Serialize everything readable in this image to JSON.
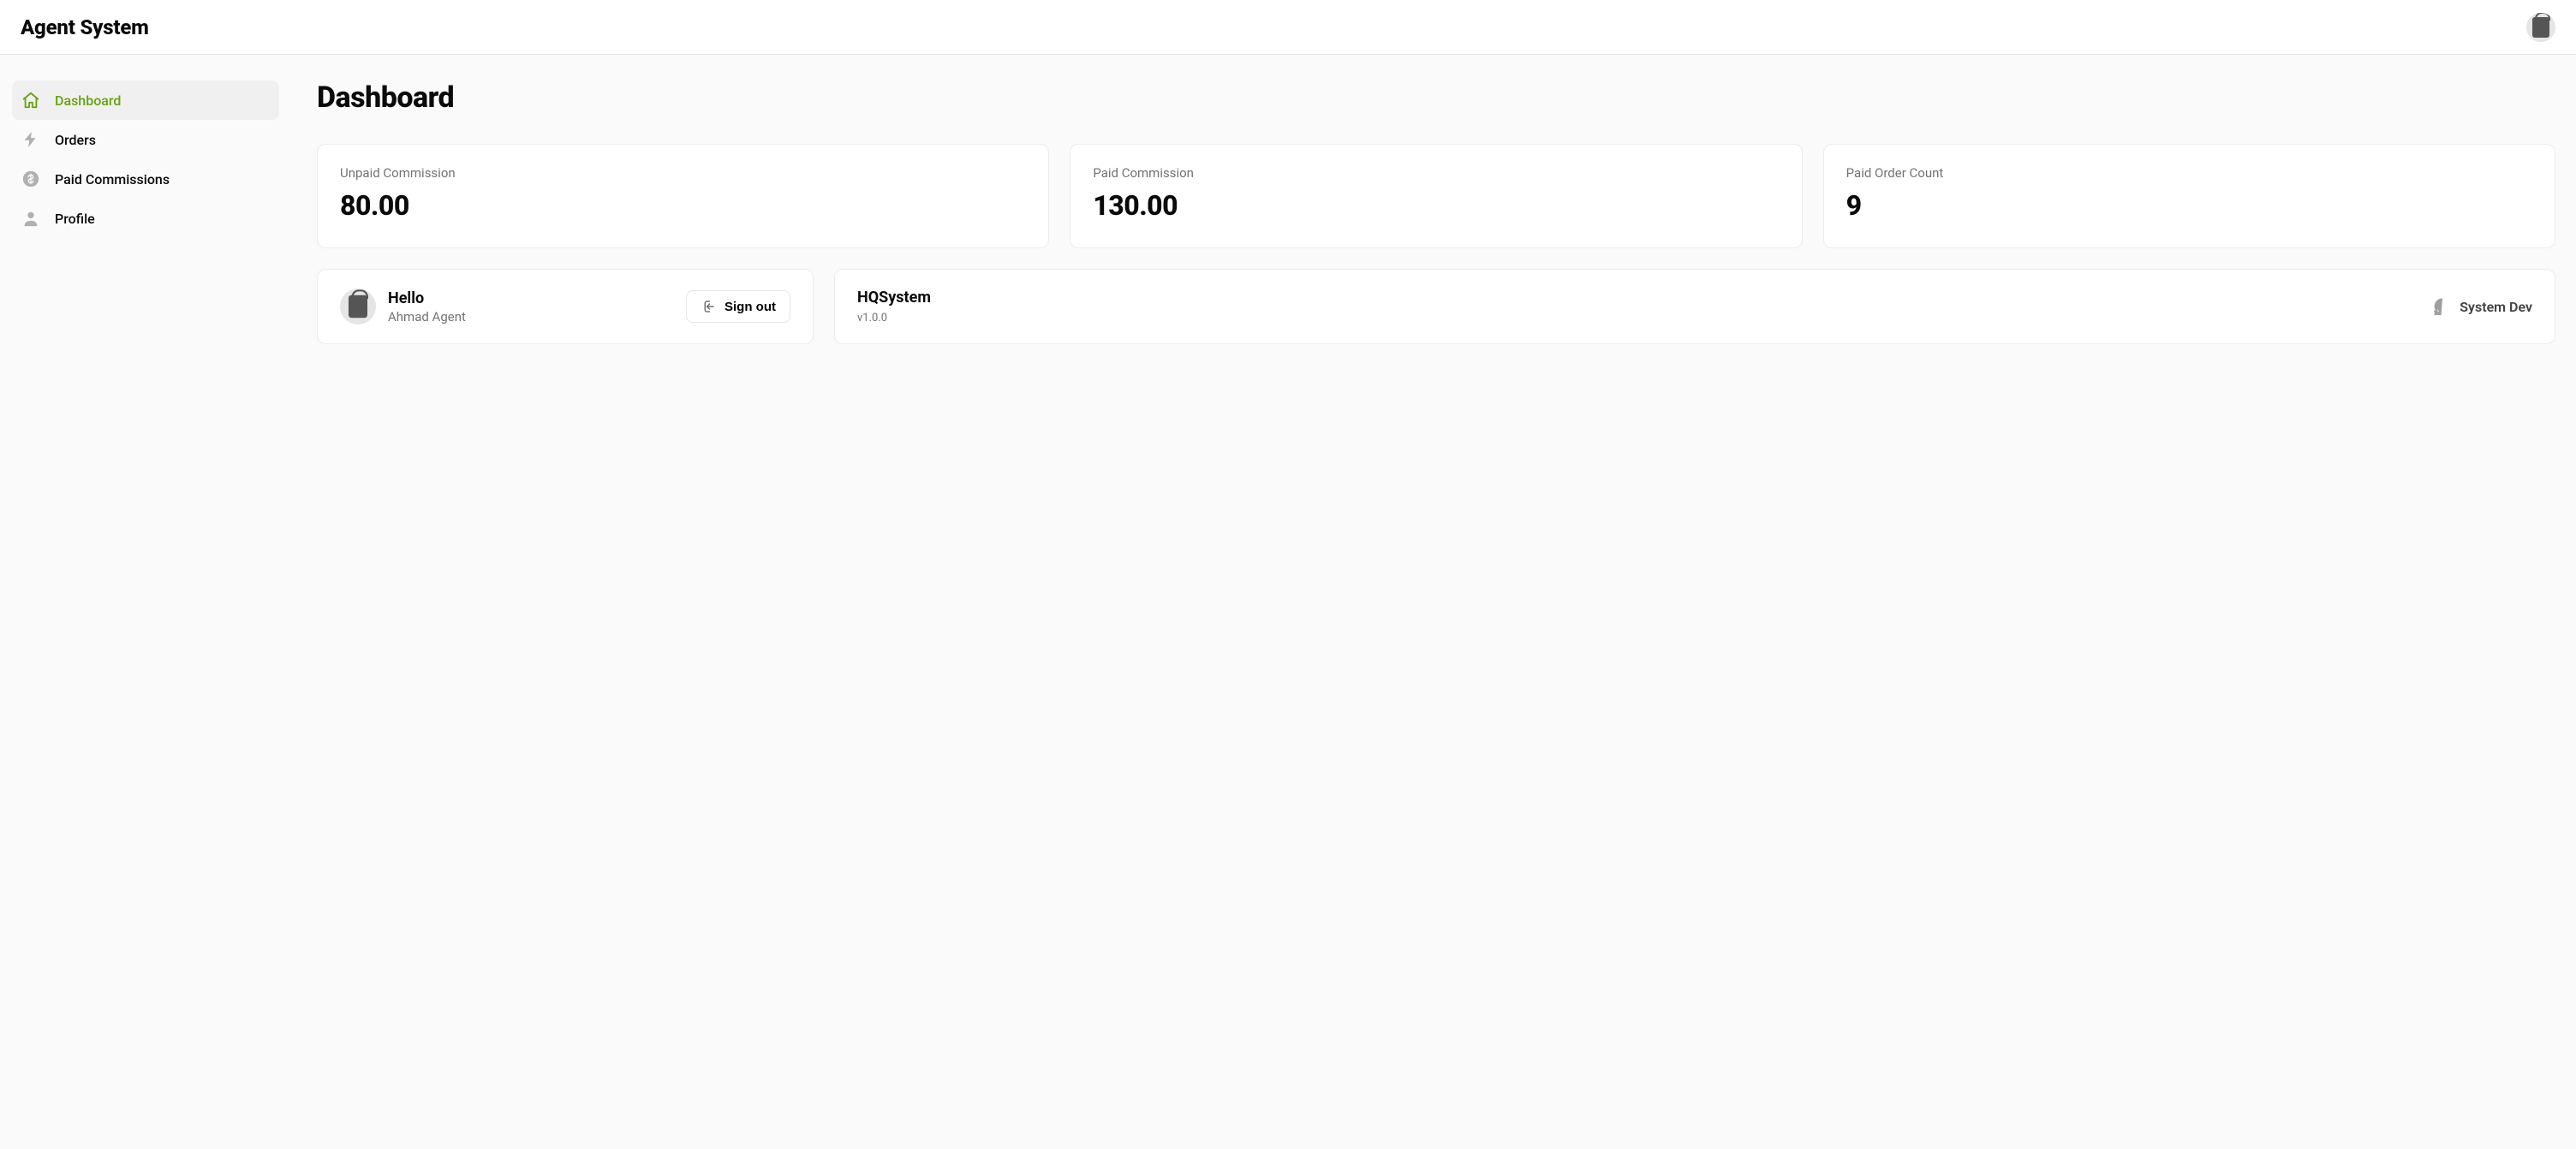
{
  "app": {
    "title": "Agent System"
  },
  "sidebar": {
    "items": [
      {
        "label": "Dashboard"
      },
      {
        "label": "Orders"
      },
      {
        "label": "Paid Commissions"
      },
      {
        "label": "Profile"
      }
    ]
  },
  "page": {
    "title": "Dashboard"
  },
  "stats": [
    {
      "label": "Unpaid Commission",
      "value": "80.00"
    },
    {
      "label": "Paid Commission",
      "value": "130.00"
    },
    {
      "label": "Paid Order Count",
      "value": "9"
    }
  ],
  "user": {
    "greeting": "Hello",
    "name": "Ahmad Agent",
    "signout_label": "Sign out"
  },
  "system": {
    "name": "HQSystem",
    "version": "v1.0.0",
    "dev_label": "System Dev"
  }
}
